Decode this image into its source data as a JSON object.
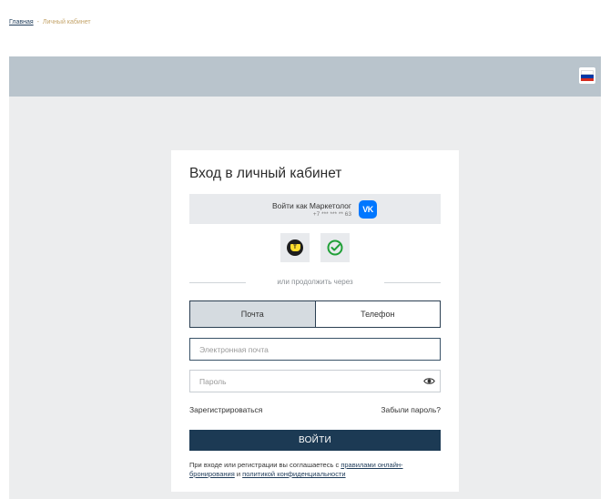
{
  "breadcrumb": {
    "home": "Главная",
    "separator": "-",
    "current": "Личный кабинет"
  },
  "header": {
    "flag_icon": "russian-flag-icon",
    "flag_colors": [
      "#ffffff",
      "#0039a6",
      "#d52b1e"
    ]
  },
  "login": {
    "title": "Вход в личный кабинет",
    "vk": {
      "label": "Войти как Маркетолог",
      "phone": "+7 *** *** ** 63",
      "logo_text": "VK",
      "brand_color": "#0077ff"
    },
    "social": {
      "tinkoff_icon": "tinkoff-id-icon",
      "sber_icon": "sber-id-icon",
      "tinkoff_glyph": "T"
    },
    "divider_text": "или продолжить через",
    "tabs": [
      "Почта",
      "Телефон"
    ],
    "active_tab": "Почта",
    "email_placeholder": "Электронная почта",
    "password_placeholder": "Пароль",
    "register_link": "Зарегистрироваться",
    "forgot_link": "Забыли пароль?",
    "submit_label": "ВОЙТИ",
    "consent": {
      "prefix": "При входе или регистрации вы соглашаетесь с ",
      "link1": "правилами онлайн-бронирования",
      "middle": " и ",
      "link2": "политикой конфиденциальности"
    }
  },
  "colors": {
    "accent": "#1c3a54",
    "band": "#b9c4cc",
    "background": "#ecedee",
    "breadcrumb_current": "#c4a46b"
  }
}
